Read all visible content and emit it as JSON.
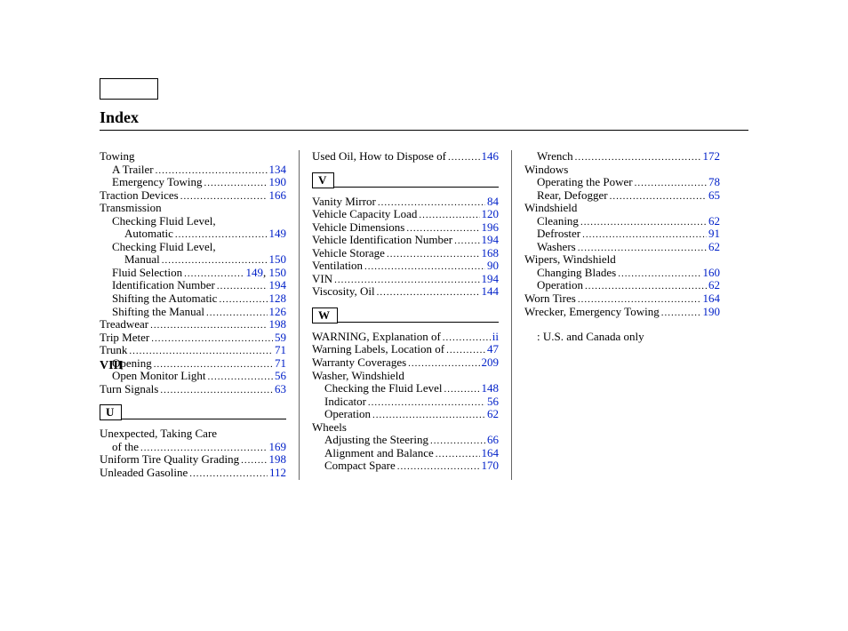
{
  "title": "Index",
  "footer": "VIII",
  "note": ": U.S. and Canada only",
  "columns": [
    {
      "blocks": [
        {
          "type": "entries",
          "items": [
            {
              "label": "Towing",
              "indent": 0
            },
            {
              "label": "A Trailer",
              "indent": 1,
              "page": "134"
            },
            {
              "label": "Emergency Towing",
              "indent": 1,
              "page": "190"
            },
            {
              "label": "Traction Devices",
              "indent": 0,
              "page": "166"
            },
            {
              "label": "Transmission",
              "indent": 0
            },
            {
              "label": "Checking Fluid Level,",
              "indent": 1
            },
            {
              "label": "Automatic",
              "indent": 2,
              "page": "149"
            },
            {
              "label": "Checking Fluid Level,",
              "indent": 1
            },
            {
              "label": "Manual",
              "indent": 2,
              "page": "150"
            },
            {
              "label": "Fluid Selection",
              "indent": 1,
              "pages": [
                "149",
                "150"
              ]
            },
            {
              "label": "Identification Number",
              "indent": 1,
              "page": "194"
            },
            {
              "label": "Shifting the Automatic",
              "indent": 1,
              "page": "128"
            },
            {
              "label": "Shifting the Manual",
              "indent": 1,
              "page": "126"
            },
            {
              "label": "Treadwear",
              "indent": 0,
              "page": "198"
            },
            {
              "label": "Trip Meter",
              "indent": 0,
              "page": "59"
            },
            {
              "label": "Trunk",
              "indent": 0,
              "page": "71"
            },
            {
              "label": "Opening",
              "indent": 1,
              "page": "71"
            },
            {
              "label": "Open Monitor Light",
              "indent": 1,
              "page": "56"
            },
            {
              "label": "Turn Signals",
              "indent": 0,
              "page": "63"
            }
          ]
        },
        {
          "type": "letter",
          "letter": "U"
        },
        {
          "type": "entries",
          "items": [
            {
              "label": "Unexpected, Taking Care",
              "indent": 0
            },
            {
              "label": "of the",
              "indent": 1,
              "page": "169"
            },
            {
              "label": "Uniform Tire Quality Grading",
              "indent": 0,
              "page": "198"
            },
            {
              "label": "Unleaded Gasoline",
              "indent": 0,
              "page": "112"
            }
          ]
        }
      ]
    },
    {
      "blocks": [
        {
          "type": "entries",
          "items": [
            {
              "label": "Used Oil, How to Dispose of",
              "indent": 0,
              "page": "146"
            }
          ]
        },
        {
          "type": "letter",
          "letter": "V"
        },
        {
          "type": "entries",
          "items": [
            {
              "label": "Vanity Mirror",
              "indent": 0,
              "page": "84"
            },
            {
              "label": "Vehicle Capacity Load",
              "indent": 0,
              "page": "120"
            },
            {
              "label": "Vehicle Dimensions",
              "indent": 0,
              "page": "196"
            },
            {
              "label": "Vehicle Identification Number",
              "indent": 0,
              "page": "194"
            },
            {
              "label": "Vehicle Storage",
              "indent": 0,
              "page": "168"
            },
            {
              "label": "Ventilation",
              "indent": 0,
              "page": "90"
            },
            {
              "label": "VIN",
              "indent": 0,
              "page": "194"
            },
            {
              "label": "Viscosity, Oil",
              "indent": 0,
              "page": "144"
            }
          ]
        },
        {
          "type": "letter",
          "letter": "W"
        },
        {
          "type": "entries",
          "items": [
            {
              "label": "WARNING, Explanation of",
              "indent": 0,
              "page": "ii"
            },
            {
              "label": "Warning Labels, Location of",
              "indent": 0,
              "page": "47"
            },
            {
              "label": "Warranty Coverages  ",
              "indent": 0,
              "page": "209"
            },
            {
              "label": "Washer, Windshield",
              "indent": 0
            },
            {
              "label": "Checking the Fluid Level",
              "indent": 1,
              "page": "148"
            },
            {
              "label": "Indicator",
              "indent": 1,
              "page": "56"
            },
            {
              "label": "Operation",
              "indent": 1,
              "page": "62"
            },
            {
              "label": "Wheels",
              "indent": 0
            },
            {
              "label": "Adjusting the Steering",
              "indent": 1,
              "page": "66"
            },
            {
              "label": "Alignment and Balance",
              "indent": 1,
              "page": "164"
            },
            {
              "label": "Compact Spare",
              "indent": 1,
              "page": "170"
            }
          ]
        }
      ]
    },
    {
      "blocks": [
        {
          "type": "entries",
          "items": [
            {
              "label": "Wrench",
              "indent": 1,
              "page": "172"
            },
            {
              "label": "Windows",
              "indent": 0
            },
            {
              "label": "Operating the Power",
              "indent": 1,
              "page": "78"
            },
            {
              "label": "Rear, Defogger",
              "indent": 1,
              "page": "65"
            },
            {
              "label": "Windshield",
              "indent": 0
            },
            {
              "label": "Cleaning",
              "indent": 1,
              "page": "62"
            },
            {
              "label": "Defroster",
              "indent": 1,
              "page": "91"
            },
            {
              "label": "Washers",
              "indent": 1,
              "page": "62"
            },
            {
              "label": "Wipers, Windshield",
              "indent": 0
            },
            {
              "label": "Changing Blades",
              "indent": 1,
              "page": "160"
            },
            {
              "label": "Operation",
              "indent": 1,
              "page": "62"
            },
            {
              "label": "Worn Tires",
              "indent": 0,
              "page": "164"
            },
            {
              "label": "Wrecker, Emergency Towing",
              "indent": 0,
              "page": "190"
            }
          ]
        },
        {
          "type": "note"
        }
      ]
    }
  ]
}
